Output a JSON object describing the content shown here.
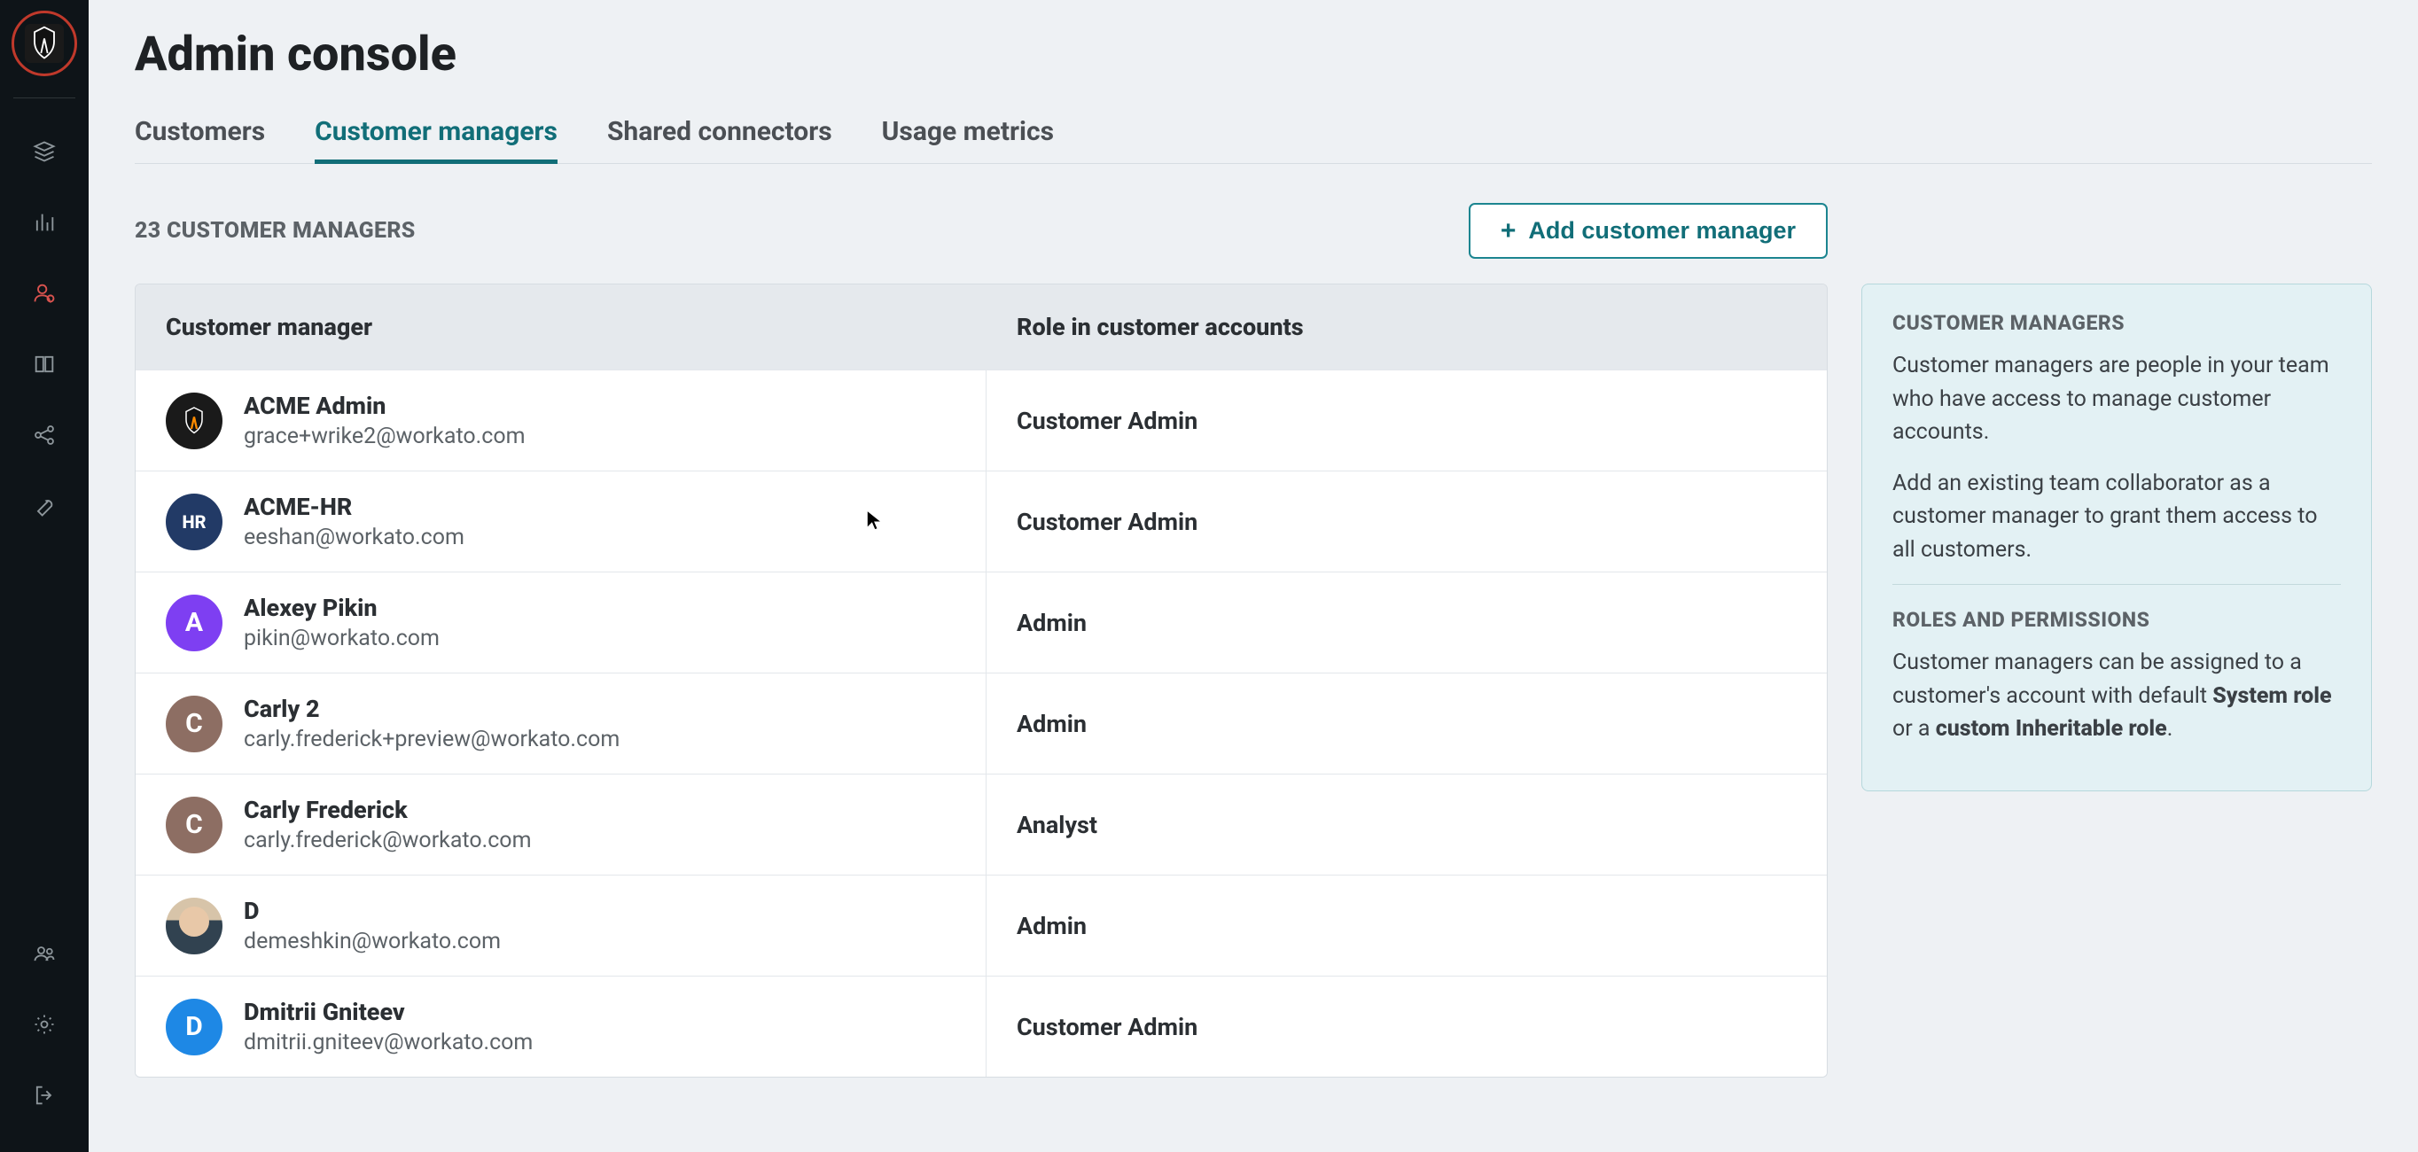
{
  "page": {
    "title": "Admin console"
  },
  "tabs": [
    {
      "id": "customers",
      "label": "Customers"
    },
    {
      "id": "customer-managers",
      "label": "Customer managers"
    },
    {
      "id": "shared-connectors",
      "label": "Shared connectors"
    },
    {
      "id": "usage-metrics",
      "label": "Usage metrics"
    }
  ],
  "active_tab": "customer-managers",
  "subhead": {
    "count_label": "23 CUSTOMER MANAGERS",
    "add_button_label": "Add customer manager"
  },
  "table": {
    "headers": {
      "col1": "Customer manager",
      "col2": "Role in customer accounts"
    },
    "rows": [
      {
        "avatar_type": "shield",
        "avatar_text": "",
        "name": "ACME Admin",
        "email": "grace+wrike2@workato.com",
        "role": "Customer Admin"
      },
      {
        "avatar_type": "hr",
        "avatar_text": "HR",
        "name": "ACME-HR",
        "email": "eeshan@workato.com",
        "role": "Customer Admin"
      },
      {
        "avatar_type": "purple",
        "avatar_text": "A",
        "name": "Alexey Pikin",
        "email": "pikin@workato.com",
        "role": "Admin"
      },
      {
        "avatar_type": "brown",
        "avatar_text": "C",
        "name": "Carly 2",
        "email": "carly.frederick+preview@workato.com",
        "role": "Admin"
      },
      {
        "avatar_type": "brown",
        "avatar_text": "C",
        "name": "Carly Frederick",
        "email": "carly.frederick@workato.com",
        "role": "Analyst"
      },
      {
        "avatar_type": "photo",
        "avatar_text": "",
        "name": "D",
        "email": "demeshkin@workato.com",
        "role": "Admin"
      },
      {
        "avatar_type": "blue",
        "avatar_text": "D",
        "name": "Dmitrii Gniteev",
        "email": "dmitrii.gniteev@workato.com",
        "role": "Customer Admin"
      }
    ]
  },
  "aside": {
    "h1": "CUSTOMER MANAGERS",
    "p1": "Customer managers are people in your team who have access to manage customer accounts.",
    "p2": "Add an existing team collaborator as a customer manager to grant them access to all customers.",
    "h2": "ROLES AND PERMISSIONS",
    "p3_pre": "Customer managers can be assigned to a customer's account with default ",
    "p3_strong1": "System role",
    "p3_mid": " or a ",
    "p3_strong2": "custom Inheritable role",
    "p3_post": "."
  },
  "sidebar": {
    "icons_top": [
      "stack",
      "chart-bars",
      "user-admin",
      "book",
      "share",
      "wrench"
    ],
    "icons_bottom": [
      "people",
      "gear",
      "logout"
    ],
    "active_icon": "user-admin"
  }
}
